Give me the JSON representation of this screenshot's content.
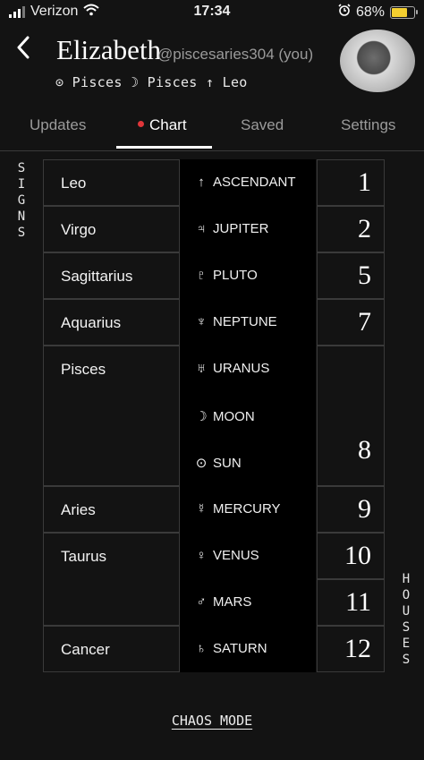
{
  "status_bar": {
    "carrier": "Verizon",
    "time": "17:34",
    "battery": "68%",
    "battery_level": 0.68
  },
  "header": {
    "name": "Elizabeth",
    "handle": "@piscesaries304 (you)",
    "big_three": "⊙ Pisces ☽ Pisces ↑ Leo"
  },
  "tabs": [
    {
      "label": "Updates",
      "active": false
    },
    {
      "label": "Chart",
      "active": true
    },
    {
      "label": "Saved",
      "active": false
    },
    {
      "label": "Settings",
      "active": false
    }
  ],
  "side_labels": {
    "left": "SIGNS",
    "right": "HOUSES"
  },
  "signs": [
    "Leo",
    "Virgo",
    "Sagittarius",
    "Aquarius",
    "Pisces",
    "Aries",
    "Taurus",
    "Cancer"
  ],
  "planets": [
    {
      "glyph": "↑",
      "name": "ASCENDANT"
    },
    {
      "glyph": "♃",
      "name": "JUPITER"
    },
    {
      "glyph": "♇",
      "name": "PLUTO"
    },
    {
      "glyph": "♆",
      "name": "NEPTUNE"
    },
    {
      "glyph": "♅",
      "name": "URANUS"
    },
    {
      "glyph": "☽",
      "name": "MOON"
    },
    {
      "glyph": "⊙",
      "name": "SUN"
    },
    {
      "glyph": "☿",
      "name": "MERCURY"
    },
    {
      "glyph": "♀",
      "name": "VENUS"
    },
    {
      "glyph": "♂",
      "name": "MARS"
    },
    {
      "glyph": "♄",
      "name": "SATURN"
    }
  ],
  "houses": [
    "1",
    "2",
    "5",
    "7",
    "8",
    "9",
    "10",
    "11",
    "12"
  ],
  "chaos_mode_label": "CHAOS MODE",
  "colors": {
    "background": "#131313",
    "active_dot": "#e0363a",
    "battery_fill": "#f4cf30"
  }
}
